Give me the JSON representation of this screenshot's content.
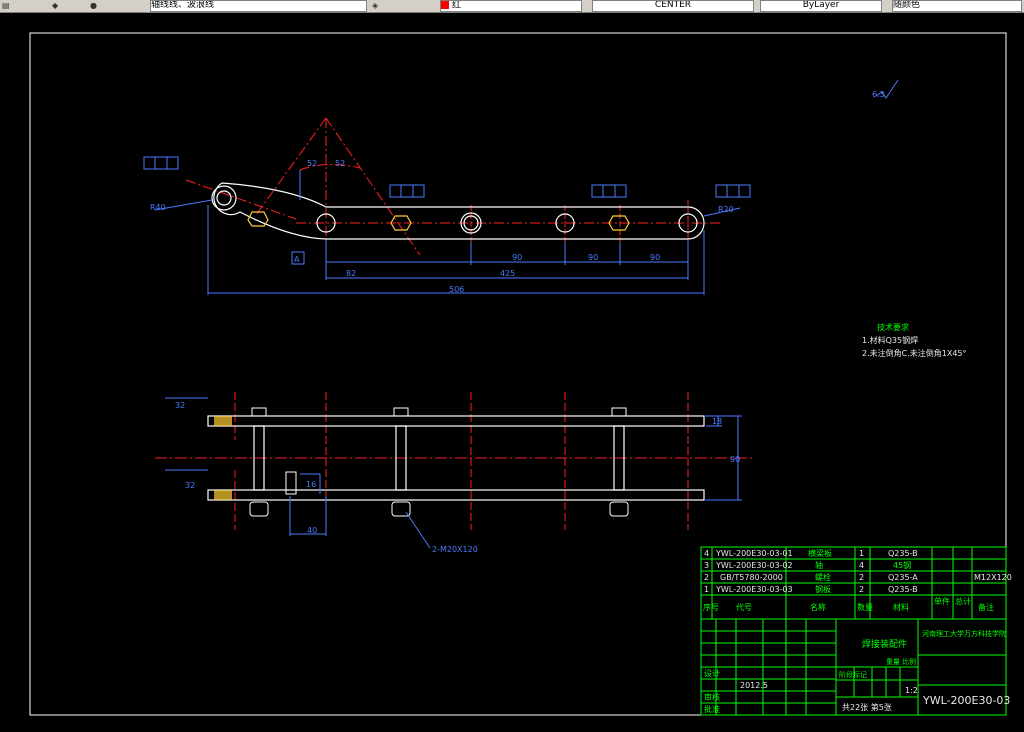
{
  "toolbar": {
    "layer_value": "轴线线、波浪线",
    "color_value": "红",
    "linetype_value": "CENTER",
    "lineweight_value": "ByLayer",
    "plotstyle_value": "随颜色"
  },
  "notes": {
    "title": "技术要求",
    "line1": "1.材料Q35钢焊",
    "line2": "2.未注倒角C.未注倒角1X45°"
  },
  "drawing": {
    "roughness_label": "6.3",
    "dim_total": "506",
    "dim_425": "425",
    "dim_82": "82",
    "dim_90a": "90",
    "dim_90b": "90",
    "dim_90c": "90",
    "dim_r40": "R40",
    "dim_r20": "R20",
    "dim_52a": "52",
    "dim_52b": "52",
    "dim_32a": "32",
    "dim_32b": "32",
    "dim_40": "40",
    "dim_18": "18",
    "dim_90v": "90",
    "dim_16": "16",
    "bolt_callout": "2-M20X120",
    "datum": "A",
    "tolerance_frames": [
      "// 0.01 A",
      "// 0.01 A",
      "// 0.01 A",
      "// 0.01 A"
    ]
  },
  "bom": {
    "rows": [
      {
        "no": "4",
        "code": "YWL-200E30-03-01",
        "name": "横梁板",
        "qty": "1",
        "material": "Q235-B",
        "note": ""
      },
      {
        "no": "3",
        "code": "YWL-200E30-03-02",
        "name": "轴",
        "qty": "4",
        "material": "45钢",
        "note": ""
      },
      {
        "no": "2",
        "code": "GB/T5780-2000",
        "name": "螺栓",
        "qty": "2",
        "material": "Q235-A",
        "note": "M12X120"
      },
      {
        "no": "1",
        "code": "YWL-200E30-03-03",
        "name": "钢板",
        "qty": "2",
        "material": "Q235-B",
        "note": ""
      }
    ],
    "header": {
      "no": "序号",
      "code": "代号",
      "name": "名称",
      "qty": "数量",
      "material": "材料",
      "weight": "单件",
      "total": "总计",
      "note": "备注"
    }
  },
  "title_block": {
    "part_name": "焊接装配件",
    "company": "河南理工大学万方科技学院",
    "drawing_no": "YWL-200E30-03",
    "scale": "1:2",
    "date": "2012.5",
    "sheets": "共22张 第5张",
    "designer": "设计",
    "check": "审核",
    "approve": "批准",
    "stage": "阶段标记",
    "weight": "重量",
    "ratio": "比例"
  }
}
